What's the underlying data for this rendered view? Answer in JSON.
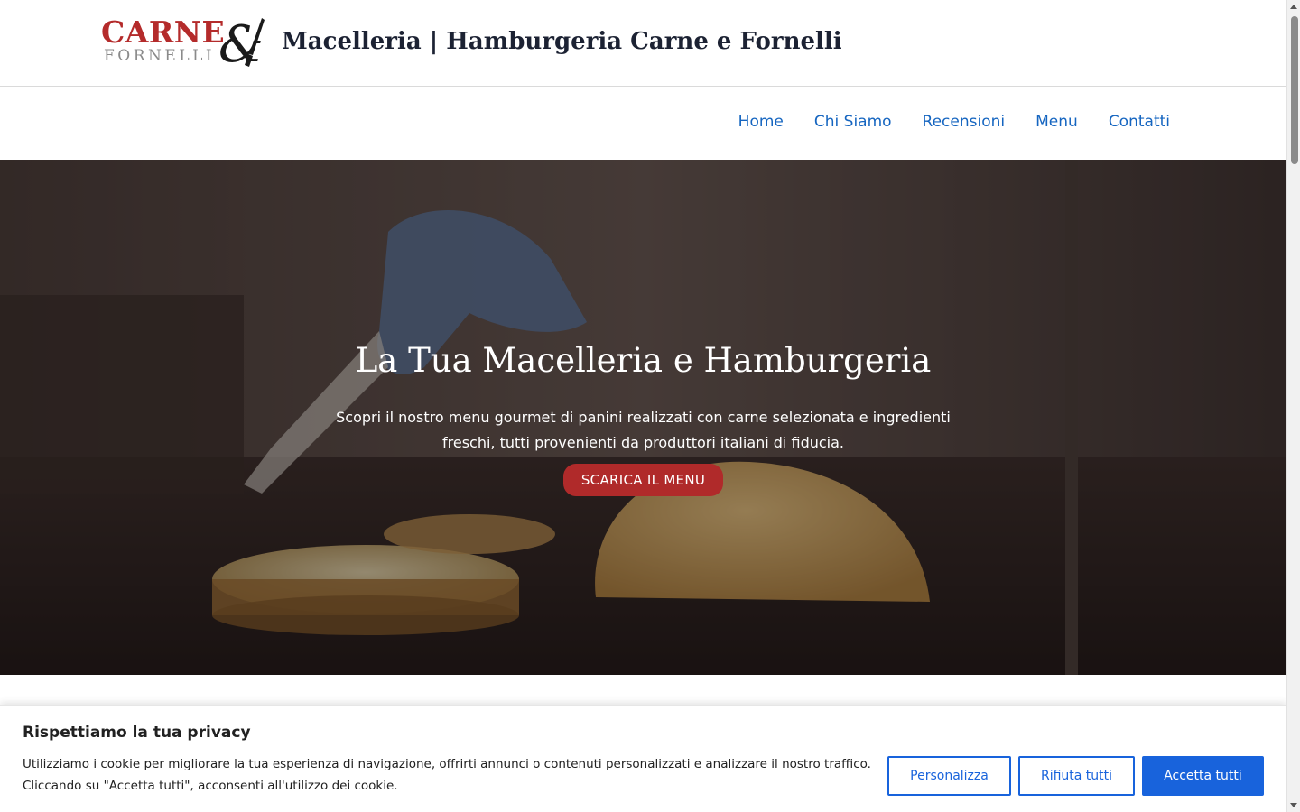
{
  "header": {
    "logo": {
      "line1": "CARNE",
      "line2": "FORNELLI",
      "symbol": "&"
    },
    "site_title": "Macelleria | Hamburgeria Carne e Fornelli"
  },
  "nav": {
    "items": [
      {
        "label": "Home"
      },
      {
        "label": "Chi Siamo"
      },
      {
        "label": "Recensioni"
      },
      {
        "label": "Menu"
      },
      {
        "label": "Contatti"
      }
    ]
  },
  "hero": {
    "title": "La Tua Macelleria e Hamburgeria",
    "text": "Scopri il nostro menu gourmet di panini realizzati con carne selezionata e ingredienti freschi, tutti provenienti da produttori italiani di fiducia.",
    "button_label": "SCARICA IL MENU"
  },
  "cookie_banner": {
    "title": "Rispettiamo la tua privacy",
    "text": "Utilizziamo i cookie per migliorare la tua esperienza di navigazione, offrirti annunci o contenuti personalizzati e analizzare il nostro traffico. Cliccando su \"Accetta tutti\", acconsenti all'utilizzo dei cookie.",
    "buttons": {
      "customize": "Personalizza",
      "reject": "Rifiuta tutti",
      "accept": "Accetta tutti"
    }
  },
  "colors": {
    "brand_red": "#b42b2b",
    "button_red": "#b02a2a",
    "link_blue": "#1565c0",
    "cookie_blue": "#1863dc"
  },
  "icons": {
    "logo_mark": "ampersand-fork-knife-icon"
  }
}
